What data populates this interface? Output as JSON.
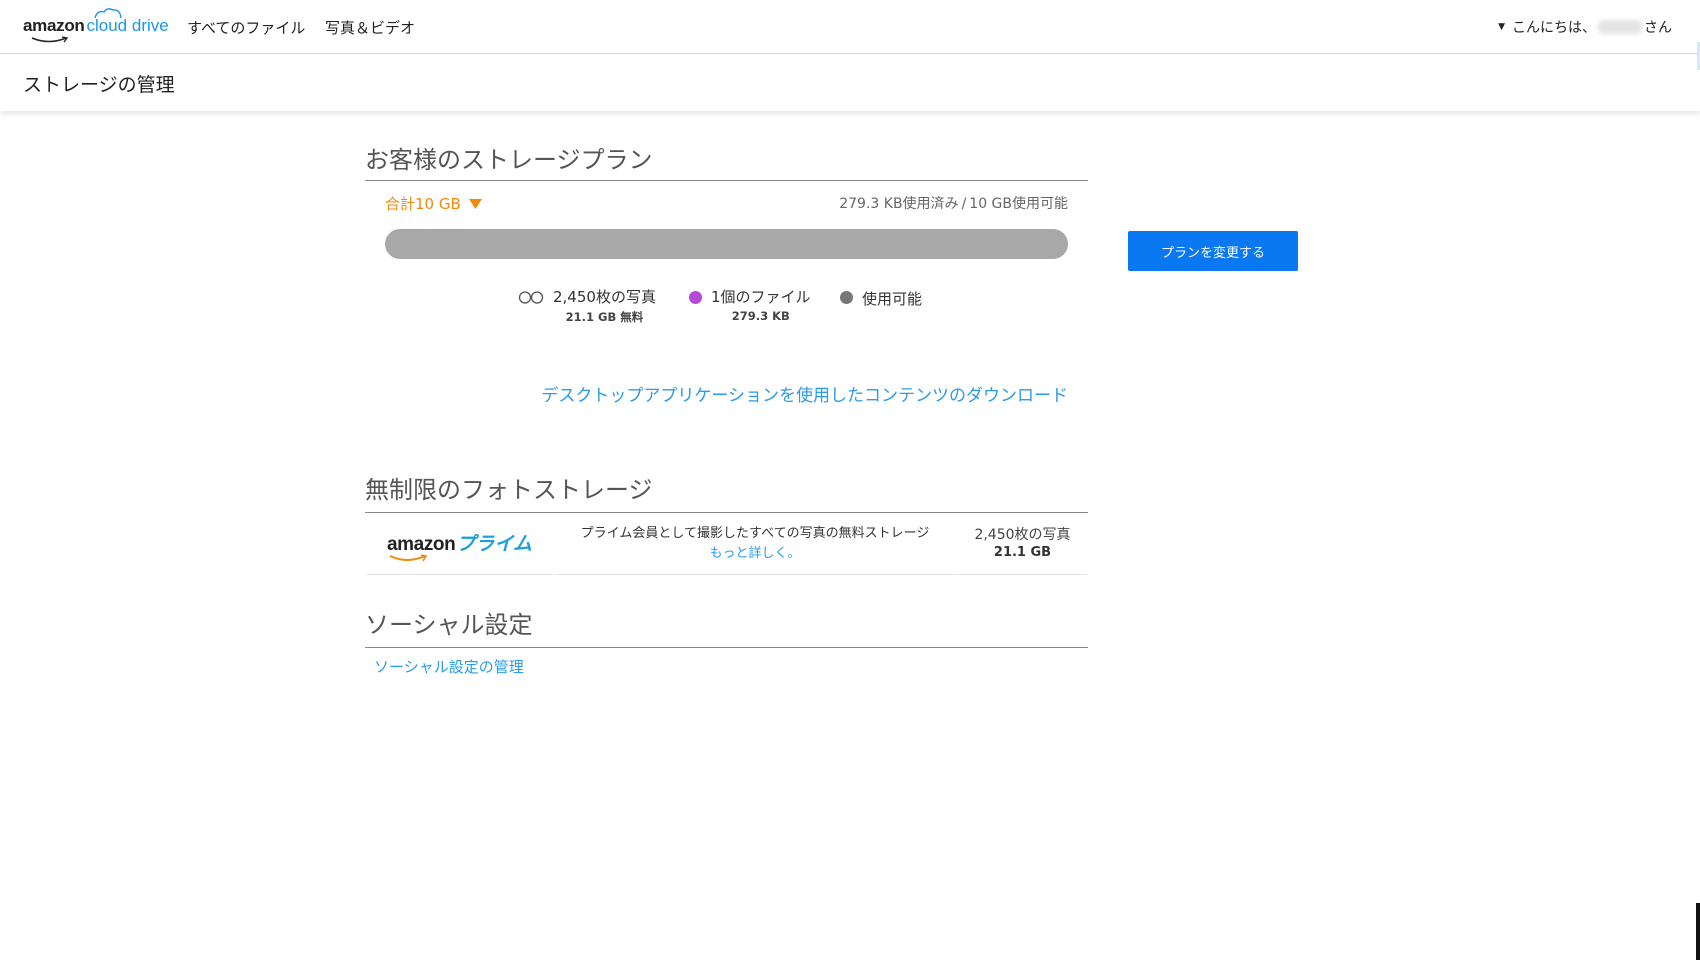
{
  "header": {
    "logo": {
      "amazon": "amazon",
      "cloud_drive": "cloud drive"
    },
    "nav": [
      {
        "label": "すべてのファイル"
      },
      {
        "label": "写真＆ビデオ"
      }
    ],
    "greeting": {
      "prefix": "こんにちは、",
      "suffix": "さん"
    }
  },
  "subheader": {
    "title": "ストレージの管理"
  },
  "storage_plan": {
    "title": "お客様のストレージプラン",
    "total_label": "合計10 GB",
    "used_text": "279.3 KB使用済み",
    "separator": "/",
    "available_text": "10 GB使用可能",
    "used_fraction": 2.79e-05,
    "legend": [
      {
        "label": "2,450枚の写真",
        "sub": "21.1 GB 無料",
        "icon": "infinity-icon"
      },
      {
        "label": "1個のファイル",
        "sub": "279.3 KB",
        "icon": "dot-icon",
        "color": "#b54ad8"
      },
      {
        "label": "使用可能",
        "sub": "",
        "icon": "dot-icon",
        "color": "#777777"
      }
    ],
    "download_link": "デスクトップアプリケーションを使用したコンテンツのダウンロード",
    "change_plan_button": "プランを変更する"
  },
  "photo_storage": {
    "title": "無制限のフォトストレージ",
    "prime_logo": {
      "amazon": "amazon",
      "prime": "プライム"
    },
    "description": "プライム会員として撮影したすべての写真の無料ストレージ",
    "more_link": "もっと詳しく。",
    "photo_count": "2,450枚の写真",
    "size": "21.1 GB"
  },
  "social": {
    "title": "ソーシャル設定",
    "manage_link": "ソーシャル設定の管理"
  },
  "colors": {
    "accent_orange": "#f08a0a",
    "link_blue": "#2a9be8",
    "button_blue": "#0a78f0",
    "files_purple": "#b54ad8",
    "available_gray": "#777777",
    "bar_gray": "#a8a8a8"
  }
}
